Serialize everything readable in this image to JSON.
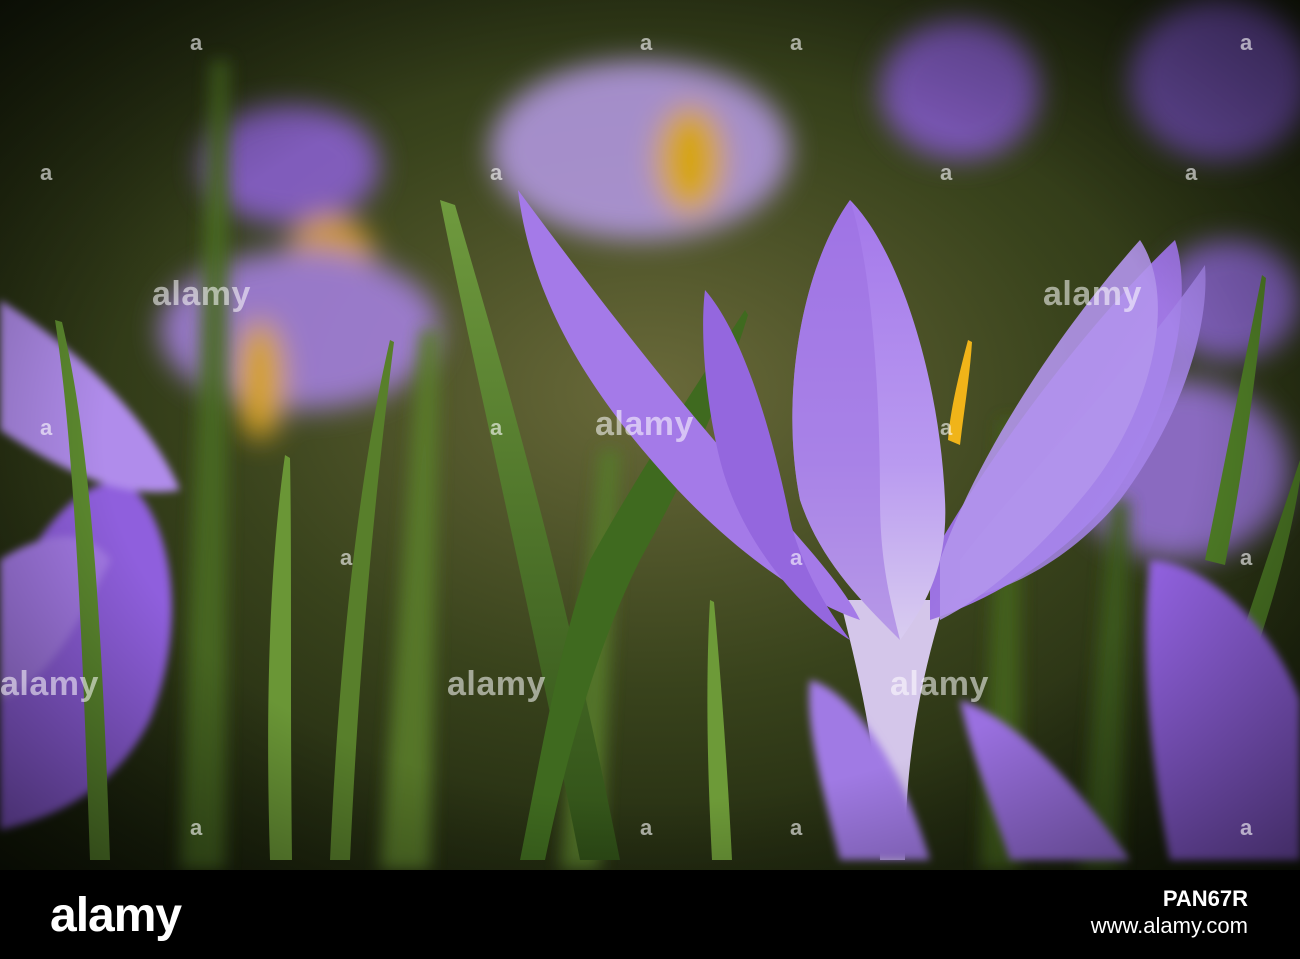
{
  "watermark": {
    "text": "alamy",
    "hash_symbol": "a"
  },
  "footer": {
    "brand": "alamy",
    "image_id": "PAN67R",
    "site": "www.alamy.com"
  },
  "colors": {
    "petal": "#9b6fe0",
    "petal_light": "#c9b0f3",
    "stamen": "#f0b419",
    "leaf": "#4f7a2a",
    "background": "#1c2410",
    "footer_bg": "#000000"
  }
}
